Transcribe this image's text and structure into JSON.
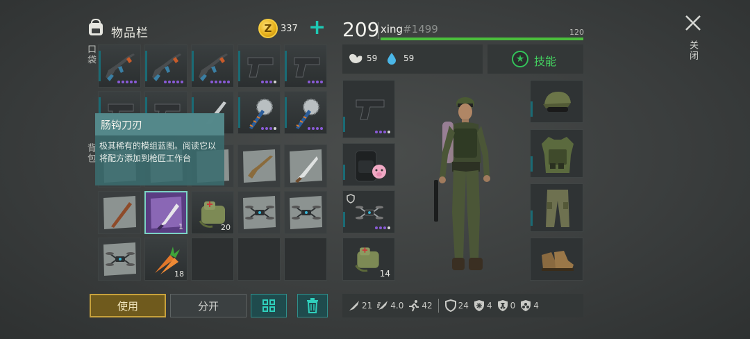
{
  "inventory": {
    "title": "物品栏",
    "coins": "337",
    "coin_symbol": "Z",
    "pocket_label": "口袋",
    "backpack_label": "背包",
    "slot_counts": {
      "medkit": "20",
      "carrots": "18",
      "cleaver": "1"
    }
  },
  "tooltip": {
    "title": "肠钩刀刃",
    "description": "极其稀有的模组蓝图。阅读它以将配方添加到枪匠工作台"
  },
  "actions": {
    "use": "使用",
    "split": "分开"
  },
  "player": {
    "level": "209",
    "name": "xing",
    "tag": "#1499",
    "xp_max": "120",
    "xp_fraction": 1.0,
    "hunger": "59",
    "thirst": "59",
    "skills_label": "技能",
    "equipped_medkit_count": "14"
  },
  "close_label": "关闭",
  "stats": {
    "attack": "21",
    "speed": "4.0",
    "move": "42",
    "armor": "24",
    "cold": "4",
    "radiation": "0",
    "toxic": "4"
  },
  "colors": {
    "accent": "#1ec9b4",
    "xp": "#4bbf3c",
    "skill": "#33c25a",
    "use_button": "#c7a13c"
  }
}
